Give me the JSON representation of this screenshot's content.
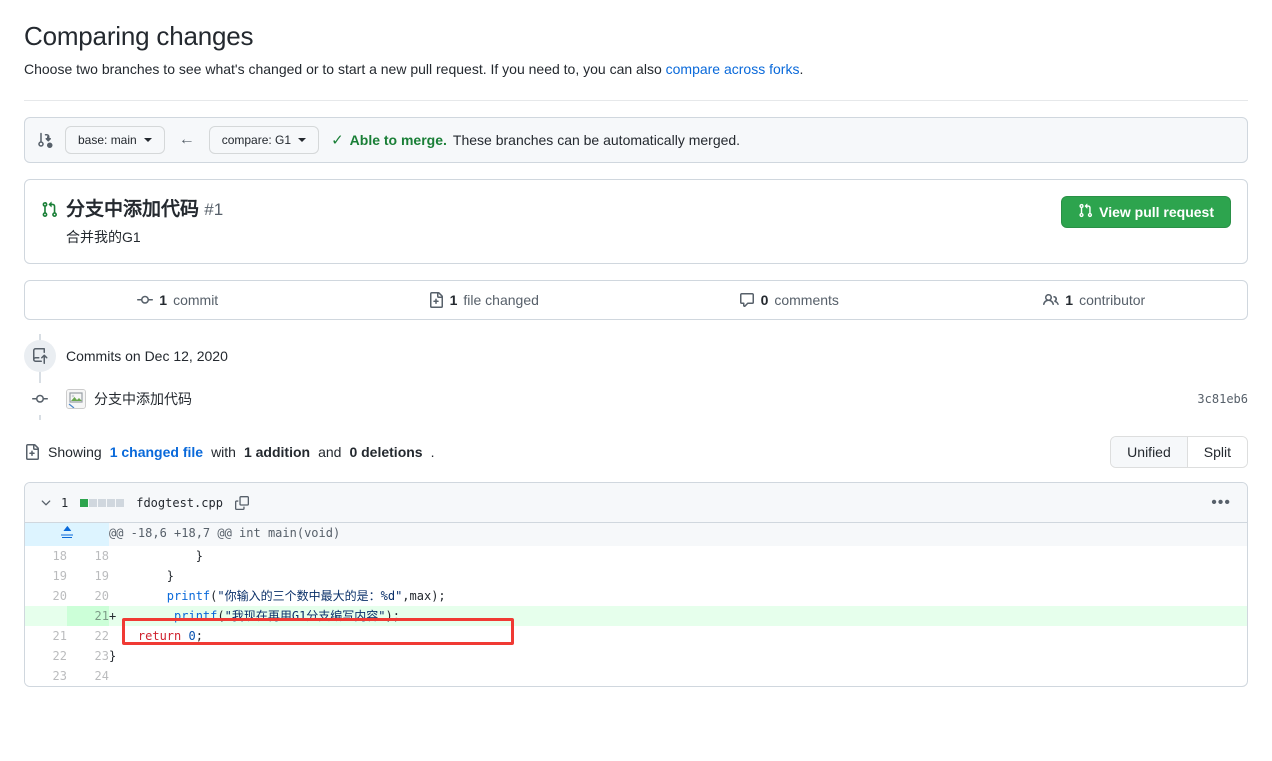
{
  "header": {
    "title": "Comparing changes",
    "subtitle_pre": "Choose two branches to see what's changed or to start a new pull request. If you need to, you can also ",
    "subtitle_link": "compare across forks",
    "subtitle_post": "."
  },
  "branch_bar": {
    "compare_icon": "git-compare-icon",
    "base_label": "base: main",
    "arrow": "←",
    "compare_label": "compare: G1",
    "check": "✓",
    "status_strong": "Able to merge.",
    "status_text": " These branches can be automatically merged."
  },
  "pull_request": {
    "icon": "git-pull-request-icon",
    "title": "分支中添加代码",
    "number": "#1",
    "description": "合并我的G1",
    "view_button": "View pull request"
  },
  "stats": [
    {
      "icon": "commit-icon",
      "count": "1",
      "label": "commit"
    },
    {
      "icon": "file-diff-icon",
      "count": "1",
      "label": "file changed"
    },
    {
      "icon": "comment-icon",
      "count": "0",
      "label": "comments"
    },
    {
      "icon": "people-icon",
      "count": "1",
      "label": "contributor"
    }
  ],
  "timeline": {
    "commits_heading": "Commits on Dec 12, 2020",
    "commit_message": "分支中添加代码",
    "commit_sha": "3c81eb6"
  },
  "showing": {
    "prefix": "Showing ",
    "changed_file_link": "1 changed file",
    "mid": " with ",
    "additions": "1 addition",
    "and": " and ",
    "deletions": "0 deletions",
    "suffix": ".",
    "unified": "Unified",
    "split": "Split"
  },
  "file": {
    "diff_count": "1",
    "name": "fdogtest.cpp",
    "kebab": "•••"
  },
  "diff": {
    "hunk_header": "@@ -18,6 +18,7 @@ int main(void)",
    "rows": [
      {
        "type": "context",
        "old": "18",
        "new": "18",
        "code": "            }"
      },
      {
        "type": "context",
        "old": "19",
        "new": "19",
        "code": "        }"
      },
      {
        "type": "context",
        "old": "20",
        "new": "20",
        "code": "        printf(\"你输入的三个数中最大的是：%d\",max);"
      },
      {
        "type": "add",
        "old": "",
        "new": "21",
        "marker": "+",
        "code": "        printf(\"我现在再用G1分支编写内容\");"
      },
      {
        "type": "context",
        "old": "21",
        "new": "22",
        "code": "    return 0;"
      },
      {
        "type": "context",
        "old": "22",
        "new": "23",
        "code": "}"
      },
      {
        "type": "context",
        "old": "23",
        "new": "24",
        "code": ""
      }
    ]
  },
  "colors": {
    "accent": "#0969da",
    "success": "#1a7f37",
    "button_green": "#2da44e",
    "annotation_red": "#f03a34",
    "add_bg": "#e6ffec",
    "add_gutter": "#ccffd8",
    "border": "#d0d7de"
  }
}
